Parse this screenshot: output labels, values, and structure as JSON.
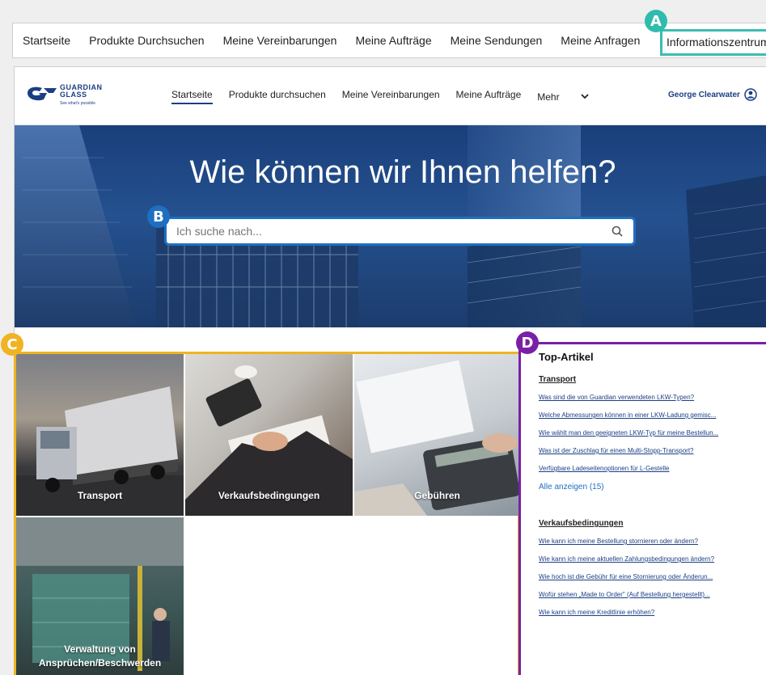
{
  "topnav": {
    "items": [
      "Startseite",
      "Produkte Durchsuchen",
      "Meine Vereinbarungen",
      "Meine Aufträge",
      "Meine Sendungen",
      "Meine Anfragen"
    ],
    "highlighted": "Informationszentrum"
  },
  "badges": {
    "a": "A",
    "b": "B",
    "c": "C",
    "d": "D"
  },
  "logo": {
    "line1": "GUARDIAN",
    "line2": "GLASS",
    "tagline": "See what's possible"
  },
  "header": {
    "nav": [
      "Startseite",
      "Produkte durchsuchen",
      "Meine Vereinbarungen",
      "Meine Aufträge"
    ],
    "more": "Mehr",
    "user": "George Clearwater"
  },
  "hero": {
    "title": "Wie können wir Ihnen helfen?",
    "search_placeholder": "Ich suche nach..."
  },
  "tiles": [
    "Transport",
    "Verkaufsbedingungen",
    "Gebühren",
    "Verwaltung von Ansprüchen/Beschwerden"
  ],
  "articles": {
    "title": "Top-Artikel",
    "cat1": "Transport",
    "cat1_links": [
      "Was sind die von Guardian verwendeten LKW-Typen?",
      "Welche Abmessungen können in einer LKW-Ladung gemisc...",
      "Wie wählt man den geeigneten LKW-Typ für meine Bestellun...",
      "Was ist der Zuschlag für einen Multi-Stopp-Transport?",
      "Verfügbare Ladeseitenoptionen für L-Gestelle"
    ],
    "show_all": "Alle anzeigen (15)",
    "cat2": "Verkaufsbedingungen",
    "cat2_links": [
      "Wie kann ich meine Bestellung stornieren oder ändern?",
      "Wie kann ich meine aktuellen Zahlungsbedingungen ändern?",
      "Wie hoch ist die Gebühr für eine Stornierung oder Änderun...",
      "Wofür stehen „Made to Order\" (Auf Bestellung hergestellt)...",
      "Wie kann ich meine Kreditlinie erhöhen?"
    ]
  },
  "colors": {
    "teal": "#3bbdb0",
    "blue": "#1f6fc0",
    "gold": "#f0b323",
    "purple": "#7a1fa8",
    "brand": "#1b3f84"
  }
}
